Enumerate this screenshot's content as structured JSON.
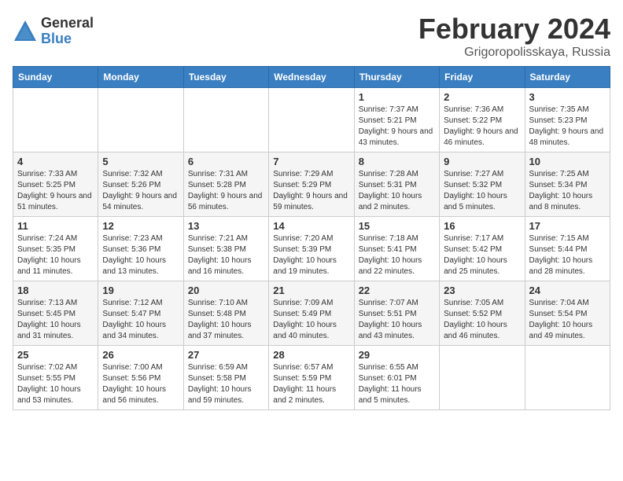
{
  "header": {
    "logo_general": "General",
    "logo_blue": "Blue",
    "month": "February 2024",
    "location": "Grigoropolisskaya, Russia"
  },
  "weekdays": [
    "Sunday",
    "Monday",
    "Tuesday",
    "Wednesday",
    "Thursday",
    "Friday",
    "Saturday"
  ],
  "weeks": [
    [
      {
        "day": "",
        "info": ""
      },
      {
        "day": "",
        "info": ""
      },
      {
        "day": "",
        "info": ""
      },
      {
        "day": "",
        "info": ""
      },
      {
        "day": "1",
        "info": "Sunrise: 7:37 AM\nSunset: 5:21 PM\nDaylight: 9 hours and 43 minutes."
      },
      {
        "day": "2",
        "info": "Sunrise: 7:36 AM\nSunset: 5:22 PM\nDaylight: 9 hours and 46 minutes."
      },
      {
        "day": "3",
        "info": "Sunrise: 7:35 AM\nSunset: 5:23 PM\nDaylight: 9 hours and 48 minutes."
      }
    ],
    [
      {
        "day": "4",
        "info": "Sunrise: 7:33 AM\nSunset: 5:25 PM\nDaylight: 9 hours and 51 minutes."
      },
      {
        "day": "5",
        "info": "Sunrise: 7:32 AM\nSunset: 5:26 PM\nDaylight: 9 hours and 54 minutes."
      },
      {
        "day": "6",
        "info": "Sunrise: 7:31 AM\nSunset: 5:28 PM\nDaylight: 9 hours and 56 minutes."
      },
      {
        "day": "7",
        "info": "Sunrise: 7:29 AM\nSunset: 5:29 PM\nDaylight: 9 hours and 59 minutes."
      },
      {
        "day": "8",
        "info": "Sunrise: 7:28 AM\nSunset: 5:31 PM\nDaylight: 10 hours and 2 minutes."
      },
      {
        "day": "9",
        "info": "Sunrise: 7:27 AM\nSunset: 5:32 PM\nDaylight: 10 hours and 5 minutes."
      },
      {
        "day": "10",
        "info": "Sunrise: 7:25 AM\nSunset: 5:34 PM\nDaylight: 10 hours and 8 minutes."
      }
    ],
    [
      {
        "day": "11",
        "info": "Sunrise: 7:24 AM\nSunset: 5:35 PM\nDaylight: 10 hours and 11 minutes."
      },
      {
        "day": "12",
        "info": "Sunrise: 7:23 AM\nSunset: 5:36 PM\nDaylight: 10 hours and 13 minutes."
      },
      {
        "day": "13",
        "info": "Sunrise: 7:21 AM\nSunset: 5:38 PM\nDaylight: 10 hours and 16 minutes."
      },
      {
        "day": "14",
        "info": "Sunrise: 7:20 AM\nSunset: 5:39 PM\nDaylight: 10 hours and 19 minutes."
      },
      {
        "day": "15",
        "info": "Sunrise: 7:18 AM\nSunset: 5:41 PM\nDaylight: 10 hours and 22 minutes."
      },
      {
        "day": "16",
        "info": "Sunrise: 7:17 AM\nSunset: 5:42 PM\nDaylight: 10 hours and 25 minutes."
      },
      {
        "day": "17",
        "info": "Sunrise: 7:15 AM\nSunset: 5:44 PM\nDaylight: 10 hours and 28 minutes."
      }
    ],
    [
      {
        "day": "18",
        "info": "Sunrise: 7:13 AM\nSunset: 5:45 PM\nDaylight: 10 hours and 31 minutes."
      },
      {
        "day": "19",
        "info": "Sunrise: 7:12 AM\nSunset: 5:47 PM\nDaylight: 10 hours and 34 minutes."
      },
      {
        "day": "20",
        "info": "Sunrise: 7:10 AM\nSunset: 5:48 PM\nDaylight: 10 hours and 37 minutes."
      },
      {
        "day": "21",
        "info": "Sunrise: 7:09 AM\nSunset: 5:49 PM\nDaylight: 10 hours and 40 minutes."
      },
      {
        "day": "22",
        "info": "Sunrise: 7:07 AM\nSunset: 5:51 PM\nDaylight: 10 hours and 43 minutes."
      },
      {
        "day": "23",
        "info": "Sunrise: 7:05 AM\nSunset: 5:52 PM\nDaylight: 10 hours and 46 minutes."
      },
      {
        "day": "24",
        "info": "Sunrise: 7:04 AM\nSunset: 5:54 PM\nDaylight: 10 hours and 49 minutes."
      }
    ],
    [
      {
        "day": "25",
        "info": "Sunrise: 7:02 AM\nSunset: 5:55 PM\nDaylight: 10 hours and 53 minutes."
      },
      {
        "day": "26",
        "info": "Sunrise: 7:00 AM\nSunset: 5:56 PM\nDaylight: 10 hours and 56 minutes."
      },
      {
        "day": "27",
        "info": "Sunrise: 6:59 AM\nSunset: 5:58 PM\nDaylight: 10 hours and 59 minutes."
      },
      {
        "day": "28",
        "info": "Sunrise: 6:57 AM\nSunset: 5:59 PM\nDaylight: 11 hours and 2 minutes."
      },
      {
        "day": "29",
        "info": "Sunrise: 6:55 AM\nSunset: 6:01 PM\nDaylight: 11 hours and 5 minutes."
      },
      {
        "day": "",
        "info": ""
      },
      {
        "day": "",
        "info": ""
      }
    ]
  ]
}
